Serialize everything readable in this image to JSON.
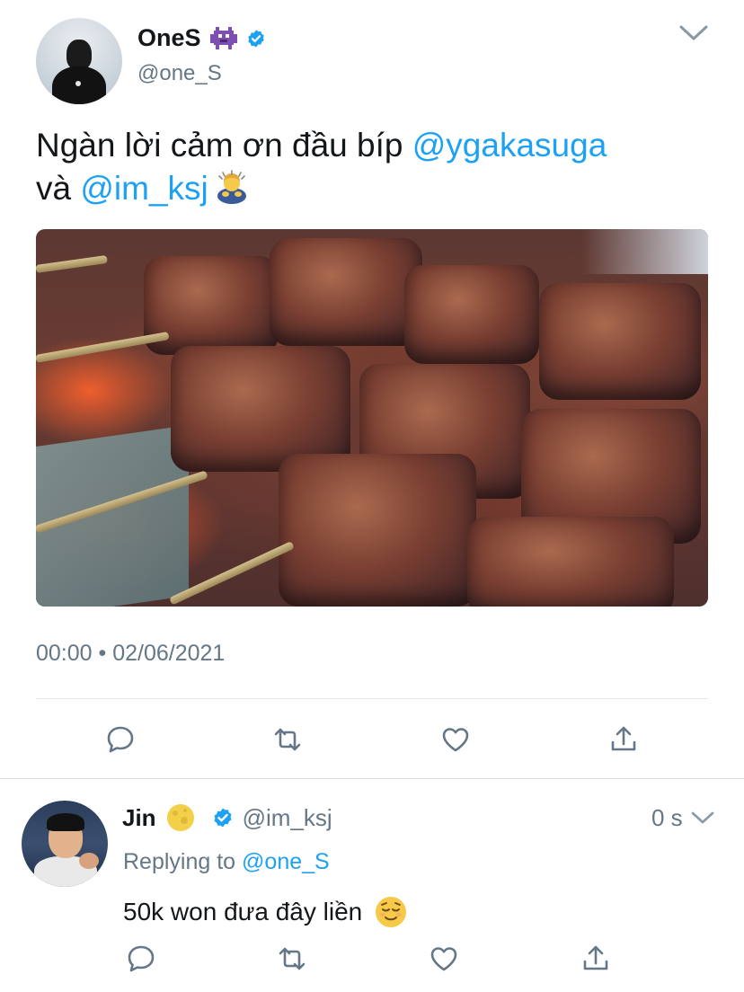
{
  "main_tweet": {
    "display_name": "OneS",
    "name_emoji": "alien-monster-emoji",
    "handle": "@one_S",
    "text_part1": "Ngàn lời cảm ơn đầu bíp ",
    "mention1": "@ygakasuga",
    "text_part2": "và ",
    "mention2": "@im_ksj",
    "text_emoji": "person-bowing-emoji",
    "timestamp": "00:00 • 02/06/2021",
    "photo_icon": "grilled-skewers-photo",
    "actions": [
      "reply-icon",
      "retweet-icon",
      "like-icon",
      "share-icon"
    ]
  },
  "reply_tweet": {
    "display_name": "Jin",
    "name_emoji": "full-moon-emoji",
    "handle": "@im_ksj",
    "time": "0 s",
    "replying_prefix": "Replying to ",
    "replying_to": "@one_S",
    "text": "50k won đưa đây liền",
    "text_emoji": "relieved-face-emoji",
    "actions": [
      "reply-icon",
      "retweet-icon",
      "like-icon",
      "share-icon"
    ]
  },
  "colors": {
    "link": "#1da1f2",
    "secondary_text": "#657786",
    "primary_text": "#14171a",
    "verified": "#1da1f2",
    "divider": "#e1e8ed"
  }
}
